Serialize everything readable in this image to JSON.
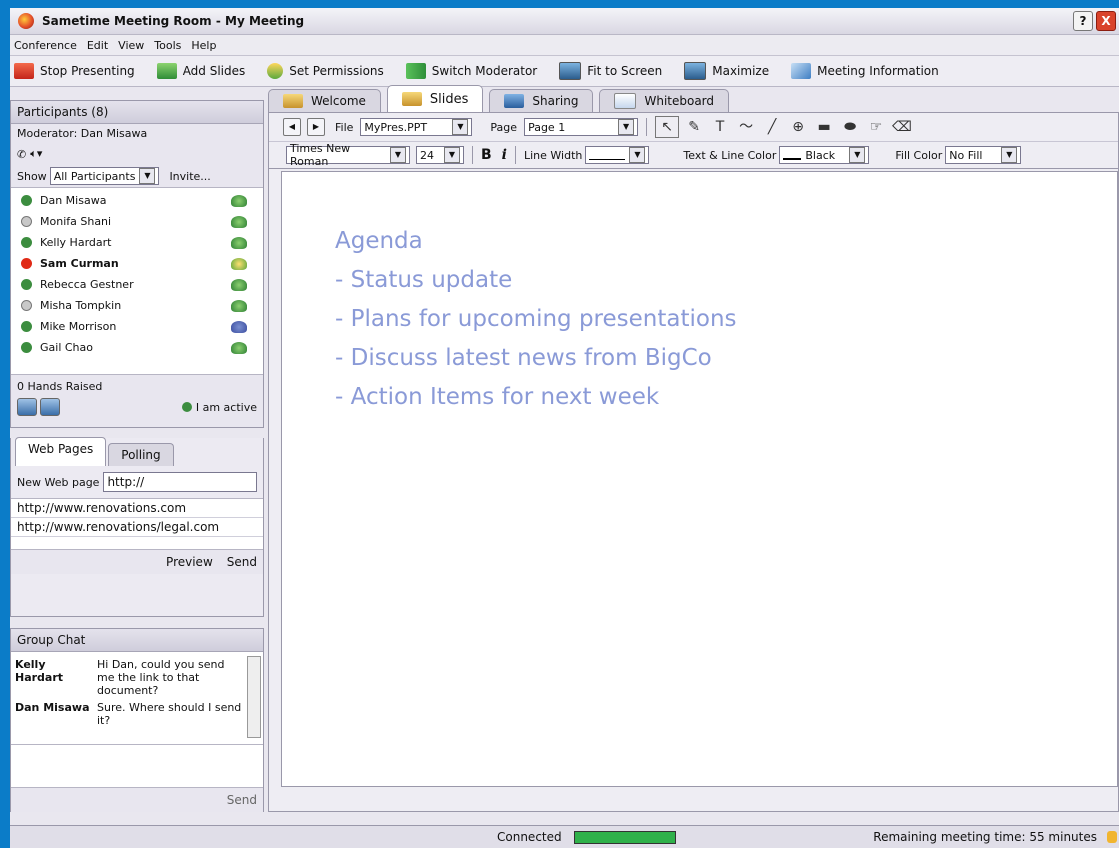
{
  "window": {
    "title": "Sametime Meeting Room - My Meeting",
    "help": "?",
    "close": "X"
  },
  "menu": [
    "Conference",
    "Edit",
    "View",
    "Tools",
    "Help"
  ],
  "toolbar": [
    {
      "label": "Stop Presenting",
      "icon": "stop-presenting-icon"
    },
    {
      "label": "Add Slides",
      "icon": "add-slides-icon"
    },
    {
      "label": "Set Permissions",
      "icon": "permissions-icon"
    },
    {
      "label": "Switch Moderator",
      "icon": "switch-moderator-icon"
    },
    {
      "label": "Fit to Screen",
      "icon": "monitor-icon"
    },
    {
      "label": "Maximize",
      "icon": "monitor-icon"
    },
    {
      "label": "Meeting Information",
      "icon": "info-icon"
    }
  ],
  "participants": {
    "header": "Participants (8)",
    "moderator": "Moderator:  Dan Misawa",
    "show_label": "Show",
    "show_value": "All Participants",
    "invite": "Invite...",
    "list": [
      {
        "name": "Dan Misawa",
        "status": "active",
        "phone": "normal"
      },
      {
        "name": "Monifa Shani",
        "status": "away",
        "phone": "normal"
      },
      {
        "name": "Kelly Hardart",
        "status": "active",
        "phone": "normal"
      },
      {
        "name": "Sam Curman",
        "status": "dnd",
        "phone": "speaking",
        "bold": true
      },
      {
        "name": "Rebecca Gestner",
        "status": "active",
        "phone": "normal"
      },
      {
        "name": "Misha Tompkin",
        "status": "away",
        "phone": "normal"
      },
      {
        "name": "Mike Morrison",
        "status": "active",
        "phone": "muted"
      },
      {
        "name": "Gail Chao",
        "status": "active",
        "phone": "normal"
      }
    ],
    "hands": "0 Hands Raised",
    "active": "I am active"
  },
  "web": {
    "tabs": [
      "Web Pages",
      "Polling"
    ],
    "new_label": "New Web page",
    "new_value": "http://",
    "urls": [
      "http://www.renovations.com",
      "http://www.renovations/legal.com"
    ],
    "preview": "Preview",
    "send": "Send"
  },
  "chat": {
    "header": "Group Chat",
    "messages": [
      {
        "who": "Kelly Hardart",
        "text": "Hi Dan, could you send me the link to that document?"
      },
      {
        "who": "Dan Misawa",
        "text": "Sure. Where should I send it?"
      }
    ],
    "send": "Send"
  },
  "main": {
    "tabs": [
      {
        "label": "Welcome"
      },
      {
        "label": "Slides",
        "active": true
      },
      {
        "label": "Sharing"
      },
      {
        "label": "Whiteboard"
      }
    ],
    "file_label": "File",
    "file_value": "MyPres.PPT",
    "page_label": "Page",
    "page_value": "Page 1",
    "font": "Times New Roman",
    "size": "24",
    "bold": "B",
    "italic": "i",
    "line_width": "Line Width",
    "text_color_label": "Text & Line Color",
    "text_color": "Black",
    "fill_label": "Fill Color",
    "fill_value": "No Fill",
    "slide_lines": [
      "Agenda",
      "- Status update",
      "- Plans for upcoming presentations",
      "- Discuss latest news from BigCo",
      "- Action Items for next week"
    ],
    "slide_color": "#8a9ad7"
  },
  "status": {
    "connected": "Connected",
    "remaining": "Remaining meeting time: 55 minutes",
    "connection_fill": 1.0
  }
}
